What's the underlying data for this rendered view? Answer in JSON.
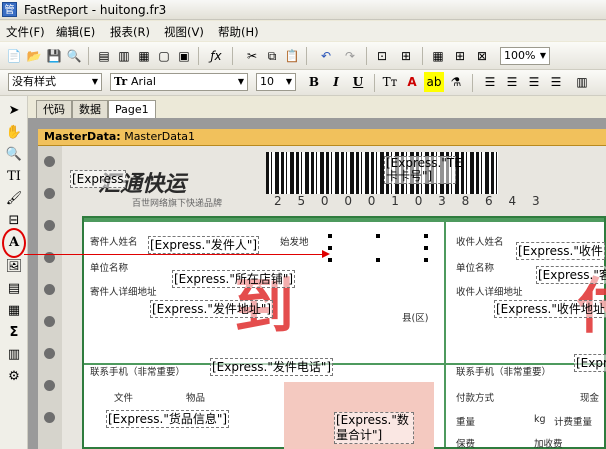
{
  "window": {
    "title": "FastReport - huitong.fr3",
    "icon_char": "管"
  },
  "menu": [
    "文件(F)",
    "编辑(E)",
    "报表(R)",
    "视图(V)",
    "帮助(H)"
  ],
  "toolbar1": {
    "zoom": "100%"
  },
  "toolbar2": {
    "style": "没有样式",
    "font": "Arial",
    "size": "10",
    "bold": "B",
    "italic": "I",
    "underline": "U"
  },
  "tabs": [
    "代码",
    "数据",
    "Page1"
  ],
  "band": {
    "type": "MasterData:",
    "name": "MasterData1"
  },
  "form": {
    "logo": "汇通快运",
    "slogan": "百世网络旗下快递品牌",
    "barcode": "2 5 0 0 0 1 0 3 8 6 4 3",
    "labels": {
      "sender_name": "寄件人姓名",
      "origin": "始发地",
      "unit_name": "单位名称",
      "sender_addr": "寄件人详细地址",
      "district": "县(区)",
      "contact": "联系手机（非常重要）",
      "doc": "文件",
      "goods": "物品",
      "recv_name": "收件人姓名",
      "recv_unit": "单位名称",
      "recv_addr": "收件人详细地址",
      "recv_contact": "联系手机（非常重要）",
      "payment": "付款方式",
      "cash": "现金",
      "weight": "重量",
      "kg": "kg",
      "billing_weight": "计费重量",
      "insured": "保费",
      "extra": "加收费"
    },
    "big_red_1": "到",
    "big_red_2": "付"
  },
  "expressions": {
    "express_top_left": "[Express",
    "express_barcode": "[Express.\"TE卡卡号\"]",
    "sender": "[Express.\"发件人\"]",
    "shop": "[Express.\"所在店铺\"]",
    "sender_addr": "[Express.\"发件地址\"]",
    "sender_phone": "[Express.\"发件电话\"]",
    "goods_info": "[Express.\"货品信息\"]",
    "qty_total": "[Express.\"数量合计\"]",
    "receiver": "[Express.\"收件",
    "receiver_2": "[Express.\"客",
    "receiver_addr": "[Express.\"收件地址",
    "receiver_phone": "[Express"
  }
}
